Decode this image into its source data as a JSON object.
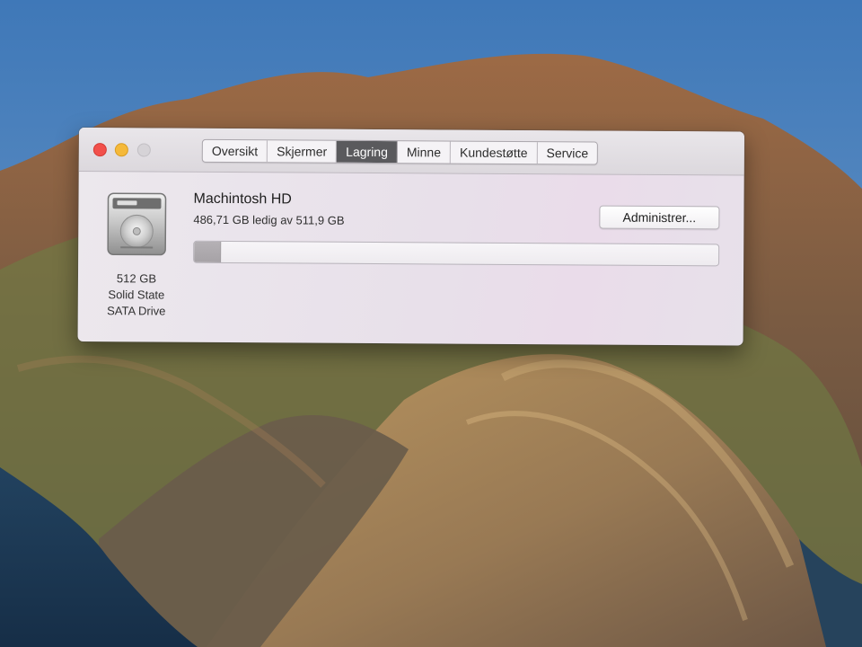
{
  "window": {
    "tabs": [
      {
        "label": "Oversikt",
        "selected": false
      },
      {
        "label": "Skjermer",
        "selected": false
      },
      {
        "label": "Lagring",
        "selected": true
      },
      {
        "label": "Minne",
        "selected": false
      },
      {
        "label": "Kundestøtte",
        "selected": false
      },
      {
        "label": "Service",
        "selected": false
      }
    ],
    "traffic_lights": [
      "close-icon",
      "minimize-icon",
      "zoom-icon"
    ]
  },
  "storage": {
    "drive_icon": "hard-drive-icon",
    "caption_lines": [
      "512 GB",
      "Solid State",
      "SATA Drive"
    ],
    "disk_name": "Machintosh HD",
    "free_text": "486,71 GB ledig av 511,9 GB",
    "manage_button": "Administrer...",
    "used_fraction": 0.049
  },
  "colors": {
    "selected_tab": "#5a5a5d",
    "close_button": "#f2504b",
    "minimize_button": "#f5b93a"
  }
}
